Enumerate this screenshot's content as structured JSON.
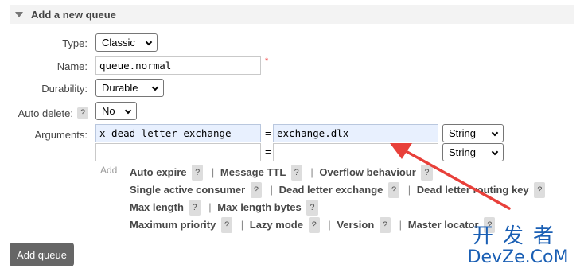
{
  "section": {
    "title": "Add a new queue"
  },
  "form": {
    "type_label": "Type:",
    "type_value": "Classic",
    "name_label": "Name:",
    "name_value": "queue.normal",
    "required_mark": "*",
    "durability_label": "Durability:",
    "durability_value": "Durable",
    "auto_delete_label": "Auto delete:",
    "auto_delete_help": "?",
    "auto_delete_value": "No",
    "arguments_label": "Arguments:",
    "arguments": [
      {
        "key": "x-dead-letter-exchange",
        "eq": "=",
        "value": "exchange.dlx",
        "type": "String"
      },
      {
        "key": "",
        "eq": "=",
        "value": "",
        "type": "String"
      }
    ],
    "add_label": "Add"
  },
  "hints": {
    "help_mark": "?",
    "separator": "|",
    "line1": [
      "Auto expire",
      "Message TTL",
      "Overflow behaviour"
    ],
    "line2": [
      "Single active consumer",
      "Dead letter exchange",
      "Dead letter routing key"
    ],
    "line3": [
      "Max length",
      "Max length bytes"
    ],
    "line4": [
      "Maximum priority",
      "Lazy mode",
      "Version",
      "Master locator"
    ]
  },
  "add_queue_button": "Add queue",
  "watermark": {
    "cn": "开发者",
    "en": "DevZe.CoM"
  },
  "colors": {
    "arrow": "#e8403a",
    "button": "#666666",
    "filled_input": "#e8f0fe",
    "watermark": "#1a5fb4"
  }
}
